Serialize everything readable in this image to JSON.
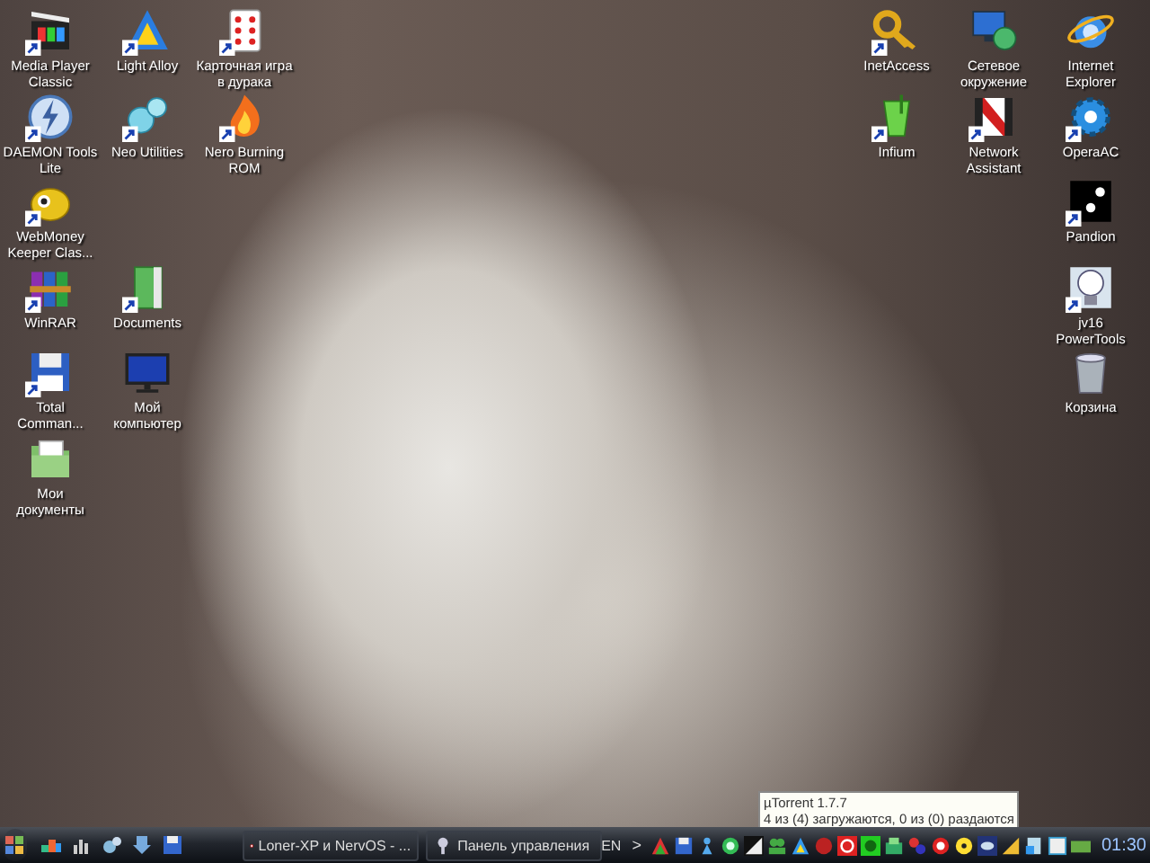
{
  "desktop": {
    "left_icon_rows": [
      [
        {
          "label": "Media Player Classic",
          "kind": "clapper",
          "shortcut": true
        },
        {
          "label": "Light Alloy",
          "kind": "triangle",
          "shortcut": true
        },
        {
          "label": "Карточная игра в дурака",
          "kind": "cards",
          "shortcut": true
        }
      ],
      [
        {
          "label": "DAEMON Tools Lite",
          "kind": "disc",
          "shortcut": true
        },
        {
          "label": "Neo Utilities",
          "kind": "bubbles",
          "shortcut": true
        },
        {
          "label": "Nero Burning ROM",
          "kind": "flame",
          "shortcut": true
        }
      ],
      [
        {
          "label": "WebMoney Keeper Clas...",
          "kind": "bug",
          "shortcut": true
        }
      ],
      [
        {
          "label": "WinRAR",
          "kind": "books",
          "shortcut": true
        },
        {
          "label": "Documents",
          "kind": "notebook",
          "shortcut": true
        }
      ],
      [
        {
          "label": "Total Comman...",
          "kind": "floppy",
          "shortcut": true
        },
        {
          "label": "Мой компьютер",
          "kind": "monitor",
          "shortcut": false
        }
      ],
      [
        {
          "label": "Мои документы",
          "kind": "folder",
          "shortcut": false
        }
      ]
    ],
    "right_icon_rows": [
      [
        {
          "label": "InetAccess",
          "kind": "key",
          "shortcut": true
        },
        {
          "label": "Сетевое окружение",
          "kind": "network",
          "shortcut": false
        },
        {
          "label": "Internet Explorer",
          "kind": "ring",
          "shortcut": false
        }
      ],
      [
        {
          "label": "Infium",
          "kind": "glass",
          "shortcut": true
        },
        {
          "label": "Network Assistant",
          "kind": "stripes",
          "shortcut": true
        },
        {
          "label": "OperaAC",
          "kind": "gear",
          "shortcut": true
        }
      ],
      [
        {
          "label": "Pandion",
          "kind": "dots",
          "shortcut": true
        }
      ],
      [
        {
          "label": "jv16 PowerTools",
          "kind": "bulb",
          "shortcut": true
        }
      ],
      [
        {
          "label": "Корзина",
          "kind": "bin",
          "shortcut": false
        }
      ]
    ]
  },
  "tooltip": {
    "title": "µTorrent 1.7.7",
    "line": "4 из (4) загружаются, 0 из (0) раздаются"
  },
  "taskbar": {
    "tasks": [
      {
        "label": "Loner-XP и NervOS - ...",
        "selected": false
      },
      {
        "label": "Панель управления",
        "selected": false
      }
    ],
    "language": "EN",
    "chevron": ">",
    "clock": "01:30"
  }
}
